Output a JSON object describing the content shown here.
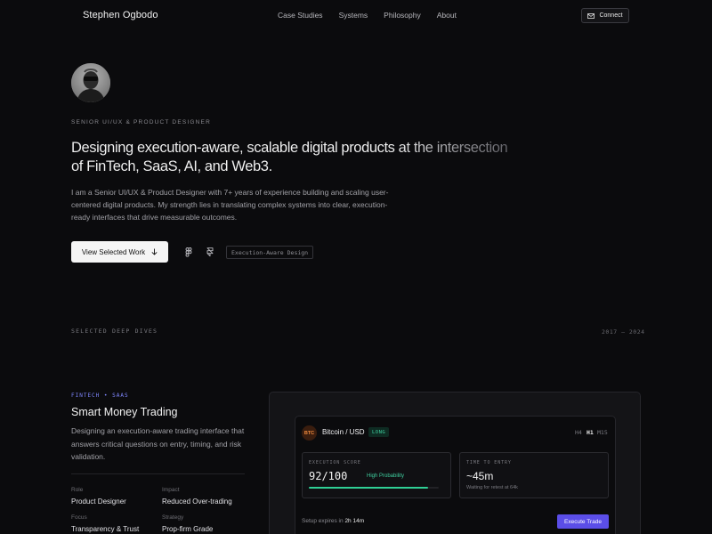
{
  "nav": {
    "brand": "Stephen Ogbodo",
    "links": [
      "Case Studies",
      "Systems",
      "Philosophy",
      "About"
    ],
    "connect_label": "Connect"
  },
  "hero": {
    "eyebrow": "SENIOR UI/UX & PRODUCT DESIGNER",
    "headline": "Designing execution-aware, scalable digital products at the intersection of FinTech, SaaS, AI, and Web3.",
    "bio": "I am a Senior UI/UX & Product Designer with 7+ years of experience building and scaling user-centered digital products. My strength lies in translating complex systems into clear, execution-ready interfaces that drive measurable outcomes.",
    "cta_label": "View Selected Work",
    "tool_icons": [
      "figma-icon",
      "framer-icon"
    ],
    "tag": "Execution-Aware Design"
  },
  "section": {
    "label": "SELECTED DEEP DIVES",
    "years": "2017 — 2024"
  },
  "case": {
    "tag": "FINTECH • SAAS",
    "title": "Smart Money Trading",
    "description": "Designing an execution-aware trading interface that answers critical questions on entry, timing, and risk validation.",
    "meta": [
      {
        "label": "Role",
        "value": "Product Designer"
      },
      {
        "label": "Impact",
        "value": "Reduced Over-trading"
      },
      {
        "label": "Focus",
        "value": "Transparency & Trust"
      },
      {
        "label": "Strategy",
        "value": "Prop-firm Grade"
      }
    ]
  },
  "widget": {
    "coin": "BTC",
    "pair": "Bitcoin / USD",
    "direction": "LONG",
    "timeframes": [
      "H4",
      "H1",
      "M15"
    ],
    "active_timeframe": "H1",
    "score_label": "EXECUTION SCORE",
    "score": "92/100",
    "score_fraction": 0.92,
    "score_note": "High Probability",
    "time_label": "TIME TO ENTRY",
    "time_value": "~45m",
    "time_note": "Waiting for retest at 64k",
    "setup_prefix": "Setup expires in",
    "setup_time": "2h 14m",
    "execute_label": "Execute Trade"
  },
  "colors": {
    "background": "#0b0b0d",
    "accent": "#5b4ee8",
    "tag": "#7f87ff",
    "success": "#3fd0a0",
    "btc": "#f08a3e"
  }
}
